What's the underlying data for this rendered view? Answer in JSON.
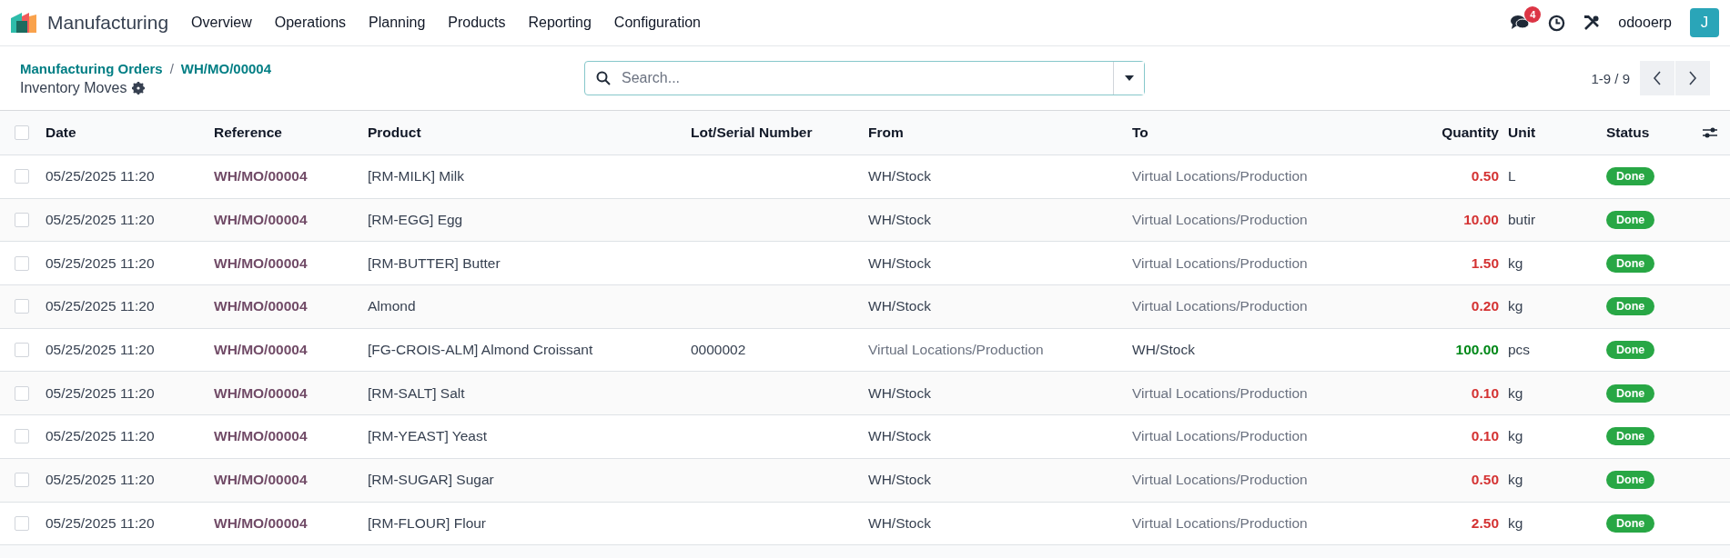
{
  "navbar": {
    "app_name": "Manufacturing",
    "menu": [
      "Overview",
      "Operations",
      "Planning",
      "Products",
      "Reporting",
      "Configuration"
    ],
    "messages_badge": "4",
    "user_name": "odooerp",
    "avatar_letter": "J"
  },
  "control_panel": {
    "breadcrumbs": [
      "Manufacturing Orders",
      "WH/MO/00004"
    ],
    "breadcrumb_separator": "/",
    "title": "Inventory Moves",
    "search": {
      "placeholder": "Search..."
    },
    "pager": "1-9 / 9"
  },
  "table": {
    "all_checked": false,
    "columns": [
      "Date",
      "Reference",
      "Product",
      "Lot/Serial Number",
      "From",
      "To",
      "Quantity",
      "Unit",
      "Status"
    ],
    "rows": [
      {
        "kind": "out",
        "date": "05/25/2025 11:20",
        "reference": "WH/MO/00004",
        "product": "[RM-MILK] Milk",
        "from": "WH/Stock",
        "to": "Virtual Locations/Production",
        "quantity": "0.50",
        "unit": "L",
        "status": "Done",
        "checked": false
      },
      {
        "kind": "out",
        "date": "05/25/2025 11:20",
        "reference": "WH/MO/00004",
        "product": "[RM-EGG] Egg",
        "from": "WH/Stock",
        "to": "Virtual Locations/Production",
        "quantity": "10.00",
        "unit": "butir",
        "status": "Done",
        "checked": false
      },
      {
        "kind": "out",
        "date": "05/25/2025 11:20",
        "reference": "WH/MO/00004",
        "product": "[RM-BUTTER] Butter",
        "from": "WH/Stock",
        "to": "Virtual Locations/Production",
        "quantity": "1.50",
        "unit": "kg",
        "status": "Done",
        "checked": false
      },
      {
        "kind": "out",
        "date": "05/25/2025 11:20",
        "reference": "WH/MO/00004",
        "product": "Almond",
        "from": "WH/Stock",
        "to": "Virtual Locations/Production",
        "quantity": "0.20",
        "unit": "kg",
        "status": "Done",
        "checked": false
      },
      {
        "kind": "in",
        "date": "05/25/2025 11:20",
        "reference": "WH/MO/00004",
        "product": "[FG-CROIS-ALM] Almond Croissant",
        "lot": "0000002",
        "from": "Virtual Locations/Production",
        "to": "WH/Stock",
        "quantity": "100.00",
        "unit": "pcs",
        "status": "Done",
        "checked": false
      },
      {
        "kind": "out",
        "date": "05/25/2025 11:20",
        "reference": "WH/MO/00004",
        "product": "[RM-SALT] Salt",
        "from": "WH/Stock",
        "to": "Virtual Locations/Production",
        "quantity": "0.10",
        "unit": "kg",
        "status": "Done",
        "checked": false
      },
      {
        "kind": "out",
        "date": "05/25/2025 11:20",
        "reference": "WH/MO/00004",
        "product": "[RM-YEAST] Yeast",
        "from": "WH/Stock",
        "to": "Virtual Locations/Production",
        "quantity": "0.10",
        "unit": "kg",
        "status": "Done",
        "checked": false
      },
      {
        "kind": "out",
        "date": "05/25/2025 11:20",
        "reference": "WH/MO/00004",
        "product": "[RM-SUGAR] Sugar",
        "from": "WH/Stock",
        "to": "Virtual Locations/Production",
        "quantity": "0.50",
        "unit": "kg",
        "status": "Done",
        "checked": false
      },
      {
        "kind": "out",
        "date": "05/25/2025 11:20",
        "reference": "WH/MO/00004",
        "product": "[RM-FLOUR] Flour",
        "from": "WH/Stock",
        "to": "Virtual Locations/Production",
        "quantity": "2.50",
        "unit": "kg",
        "status": "Done",
        "checked": false
      }
    ]
  }
}
